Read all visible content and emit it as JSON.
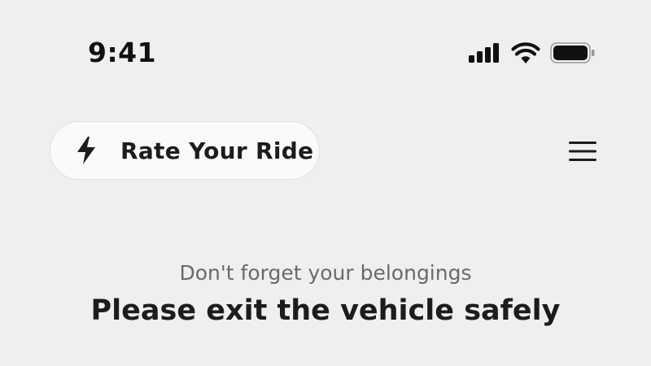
{
  "status_bar": {
    "time": "9:41",
    "icons": [
      "cellular-signal-icon",
      "wifi-icon",
      "battery-icon"
    ]
  },
  "header": {
    "rate_button": {
      "icon": "lightning-bolt-icon",
      "label": "Rate Your Ride"
    },
    "menu_icon": "hamburger-menu-icon"
  },
  "main": {
    "subtitle": "Don't forget your belongings",
    "headline": "Please exit the vehicle safely"
  },
  "colors": {
    "background": "#efefef",
    "pill_background": "#fafafa",
    "text_primary": "#1c1c1c",
    "text_secondary": "#6a6a6a"
  }
}
